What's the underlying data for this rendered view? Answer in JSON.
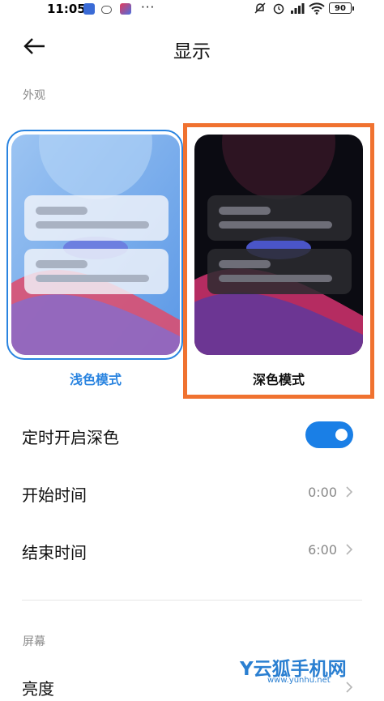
{
  "status_bar": {
    "time": "11:05",
    "dots": "···",
    "battery": "90"
  },
  "header": {
    "title": "显示"
  },
  "appearance": {
    "section_label": "外观",
    "light_label": "浅色模式",
    "dark_label": "深色模式",
    "selected": "light",
    "colors": {
      "accent": "#2a84e0",
      "highlight": "#f07230"
    }
  },
  "schedule": {
    "toggle_label": "定时开启深色",
    "toggle_on": true,
    "start_label": "开始时间",
    "start_value": "0:00",
    "end_label": "结束时间",
    "end_value": "6:00"
  },
  "screen": {
    "section_label": "屏幕",
    "brightness_label": "亮度"
  },
  "watermark": {
    "brand": "Y云狐手机网",
    "url": "www.yunhu.net"
  }
}
